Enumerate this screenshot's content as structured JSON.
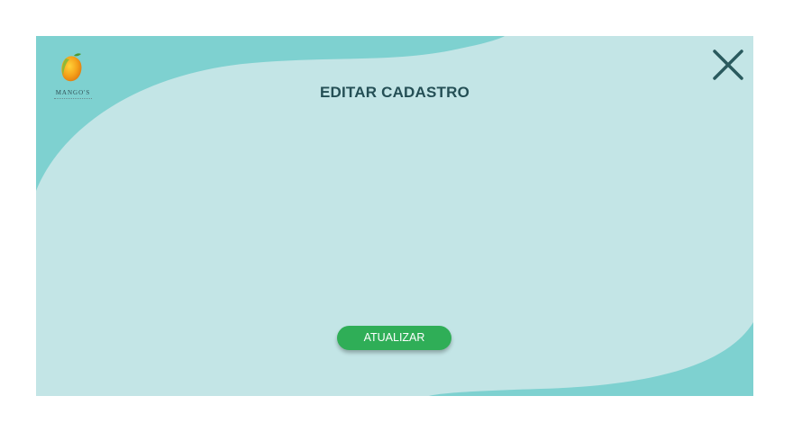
{
  "dialog": {
    "title": "EDITAR CADASTRO",
    "close_icon": "close-icon",
    "update_label": "ATUALIZAR"
  },
  "logo": {
    "text": "MANGO'S",
    "icon": "mango-icon"
  },
  "colors": {
    "background_outer": "#ffffff",
    "modal_teal": "#7ed1d0",
    "modal_light": "#c3e5e6",
    "title": "#244f55",
    "close": "#2a5a5e",
    "button": "#2fae57",
    "button_text": "#ffffff"
  }
}
